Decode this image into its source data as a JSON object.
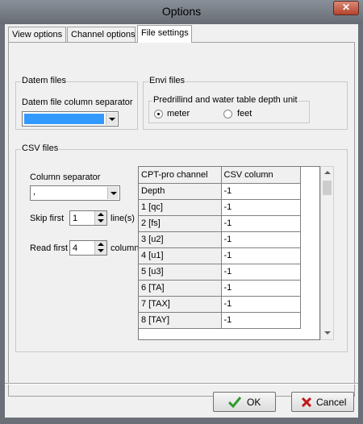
{
  "window": {
    "title": "Options",
    "close_glyph": "✕"
  },
  "tabs": [
    {
      "label": "View options"
    },
    {
      "label": "Channel options"
    },
    {
      "label": "File settings"
    }
  ],
  "datem": {
    "group_title": "Datem files",
    "separator_label": "Datem file column separator",
    "separator_value": ""
  },
  "envi": {
    "group_title": "Envi files",
    "unit_group_title": "Predrillind and water table depth unit",
    "option_meter": "meter",
    "option_feet": "feet",
    "selected": "meter"
  },
  "csv": {
    "group_title": "CSV files",
    "column_separator_label": "Column separator",
    "column_separator_value": ",",
    "skip_first_label": "Skip first",
    "skip_first_value": "1",
    "skip_unit": "line(s)",
    "read_first_label": "Read first",
    "read_first_value": "4",
    "read_unit": "column(s)",
    "table": {
      "headers": [
        "CPT-pro channel",
        "CSV column"
      ],
      "rows": [
        [
          "Depth",
          "-1"
        ],
        [
          "1 [qc]",
          "-1"
        ],
        [
          "2 [fs]",
          "-1"
        ],
        [
          "3 [u2]",
          "-1"
        ],
        [
          "4 [u1]",
          "-1"
        ],
        [
          "5 [u3]",
          "-1"
        ],
        [
          "6 [TA]",
          "-1"
        ],
        [
          "7 [TAX]",
          "-1"
        ],
        [
          "8 [TAY]",
          "-1"
        ]
      ]
    }
  },
  "footer": {
    "ok_label": "OK",
    "cancel_label": "Cancel"
  },
  "colors": {
    "selection": "#3399ff",
    "ok_check": "#2e9b2e",
    "cancel_x": "#c01818"
  }
}
